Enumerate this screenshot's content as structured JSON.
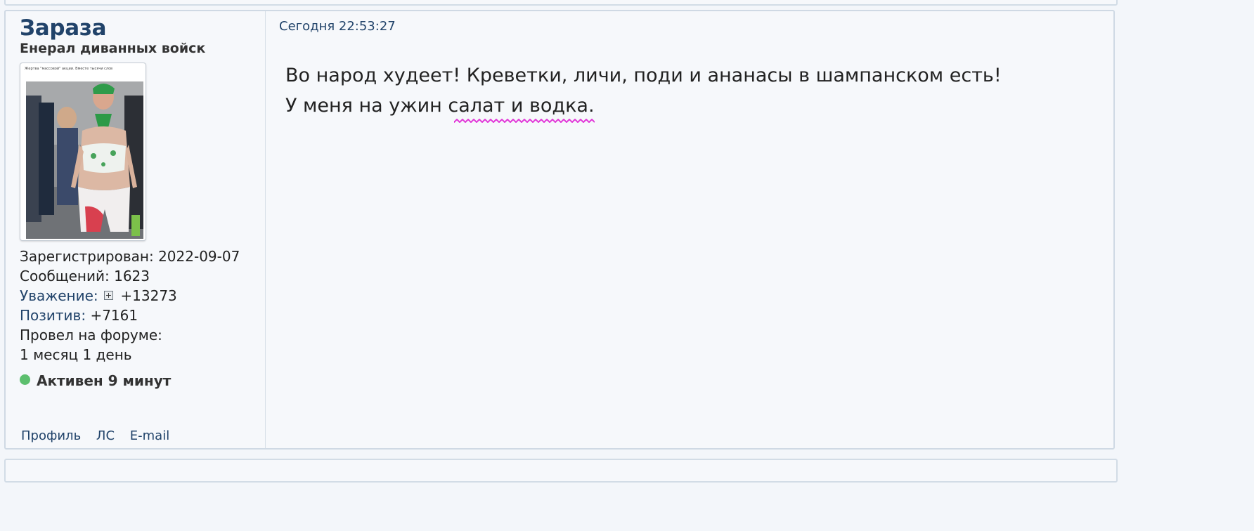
{
  "post": {
    "author": {
      "name": "Зараза",
      "title": "Енерал диванных войск",
      "avatar_caption": "Жертва \"массовой\" акции. Вместе тысячи слов",
      "registered_label": "Зарегистрирован:",
      "registered_value": "2022-09-07",
      "messages_label": "Сообщений:",
      "messages_value": "1623",
      "respect_label": "Уважение:",
      "respect_value": "+13273",
      "positive_label": "Позитив:",
      "positive_value": "+7161",
      "time_label": "Провел на форуме:",
      "time_value": "1 месяц 1 день",
      "status": "Активен 9 минут",
      "status_color": "#5cbf6e"
    },
    "date": "Сегодня 22:53:27",
    "body": {
      "line1": "Во народ худеет! Креветки, личи, поди и ананасы в шампанском есть!",
      "line2_prefix": "У меня на ужин ",
      "line2_underlined": "салат и водка",
      "line2_suffix": "."
    },
    "actions": {
      "profile": "Профиль",
      "pm": "ЛС",
      "email": "E-mail"
    }
  },
  "colors": {
    "link": "#21436a",
    "spellcheck_underline": "#e23ad9",
    "border": "#cfd9e4",
    "background": "#f6f8fb"
  }
}
